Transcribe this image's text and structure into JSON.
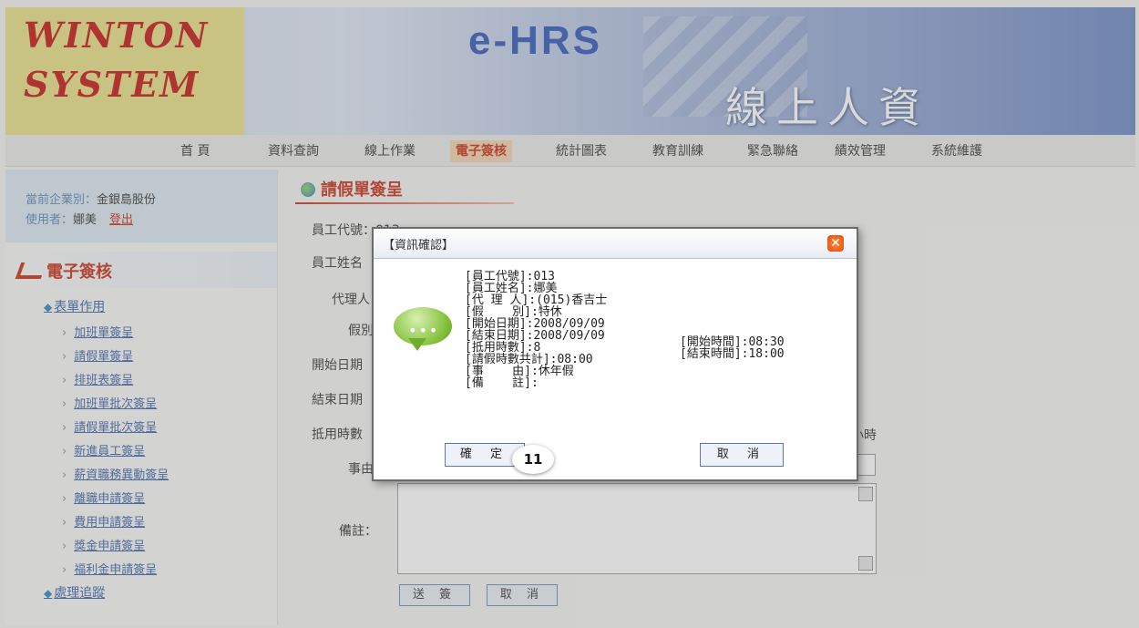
{
  "header": {
    "logo_line1": "WINTON",
    "logo_line2": "SYSTEM",
    "brand": "e-HRS",
    "tagline": "線上人資"
  },
  "nav": {
    "items": [
      {
        "label": "首 頁"
      },
      {
        "label": "資料查詢"
      },
      {
        "label": "線上作業"
      },
      {
        "label": "電子簽核"
      },
      {
        "label": "統計圖表"
      },
      {
        "label": "教育訓練"
      },
      {
        "label": "緊急聯絡"
      },
      {
        "label": "績效管理"
      },
      {
        "label": "系統維護"
      }
    ],
    "active_index": 3
  },
  "sidebar": {
    "company_label": "當前企業別：",
    "company_value": "金銀島股份",
    "user_label": "使用者：",
    "user_value": "娜美",
    "logout": "登出",
    "section_title": "電子簽核",
    "group1": "表單作用",
    "items": [
      {
        "label": "加班單簽呈"
      },
      {
        "label": "請假單簽呈"
      },
      {
        "label": "排班表簽呈"
      },
      {
        "label": "加班單批次簽呈"
      },
      {
        "label": "請假單批次簽呈"
      },
      {
        "label": "新進員工簽呈"
      },
      {
        "label": "薪資職務異動簽呈"
      },
      {
        "label": "離職申請簽呈"
      },
      {
        "label": "費用申請簽呈"
      },
      {
        "label": "獎金申請簽呈"
      },
      {
        "label": "福利金申請簽呈"
      }
    ],
    "group2": "處理追蹤"
  },
  "main": {
    "title": "請假單簽呈",
    "labels": {
      "emp_id": "員工代號：013",
      "emp_name": "員工姓名",
      "agent": "代理人",
      "leave_type": "假別",
      "start_date": "開始日期",
      "end_date": "結束日期",
      "hours": "抵用時數",
      "reason": "事由",
      "notes": "備註："
    },
    "hours_unit": "小時",
    "send_button": "送 簽",
    "cancel_button": "取 消"
  },
  "dialog": {
    "title": "【資訊確認】",
    "close_icon": "close-icon",
    "lines": [
      "[員工代號]:013",
      "[員工姓名]:娜美",
      "[代 理 人]:(015)香吉士",
      "[假    別]:特休",
      "[開始日期]:2008/09/09",
      "[結束日期]:2008/09/09",
      "[抵用時數]:8",
      "[請假時數共計]:08:00",
      "[事    由]:休年假",
      "[備    註]:"
    ],
    "start_time": "[開始時間]:08:30",
    "end_time": "[結束時間]:18:00",
    "ok_button": "確 定",
    "cancel_button": "取 消",
    "callout": "11"
  },
  "colors": {
    "accent": "#c82d14",
    "link": "#3a62a8",
    "active_tab_bg": "#f3d3ad"
  }
}
